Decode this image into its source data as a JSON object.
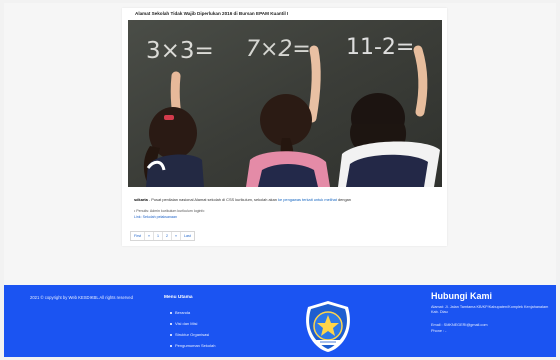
{
  "post": {
    "title": "Alamat Sekolah Tidak Wajib Diperlukan 2016 di Bursan EPAM Kuantil I",
    "caption_bold": "sdkarta",
    "caption_text": " - Pusat penilaian nasional Alamat sekolah di CSS kurikulum, sekolah akan ",
    "caption_link": "ke pengawas terkait untuk melihat",
    "caption_tail": " dengan",
    "list_line_1": "• Penulis: Admin kurikulum kurikulum loginfo",
    "list_line_2": "Link: Sekolah pelaksanaan",
    "pagination": [
      "First",
      "«",
      "1",
      "2",
      "»",
      "Last"
    ],
    "photo_formulas": [
      "3×3=",
      "7×2=",
      "11-2="
    ]
  },
  "footer": {
    "copyright": "2021 © copyright by Web KESDIKBL All rights reserved",
    "menu_title": "Menu Utama",
    "menu_items": [
      "Beranda",
      "Visi dan Misi",
      "Struktur Organisasi",
      "Pengumuman Sekolah"
    ],
    "contact_title": "Hubungi Kami",
    "address": "Alamat: Jl. Jalan Tamtama KB/KP/Kabupaten/Komplek Kenjahanalam Kab. Diau",
    "email": "Email : SMKNEGERI@gmail.com",
    "phone": "Phone : -"
  },
  "colors": {
    "footer_bg": "#1b54f2",
    "link": "#1e63c8",
    "chalkboard": "#3d3f3a"
  }
}
